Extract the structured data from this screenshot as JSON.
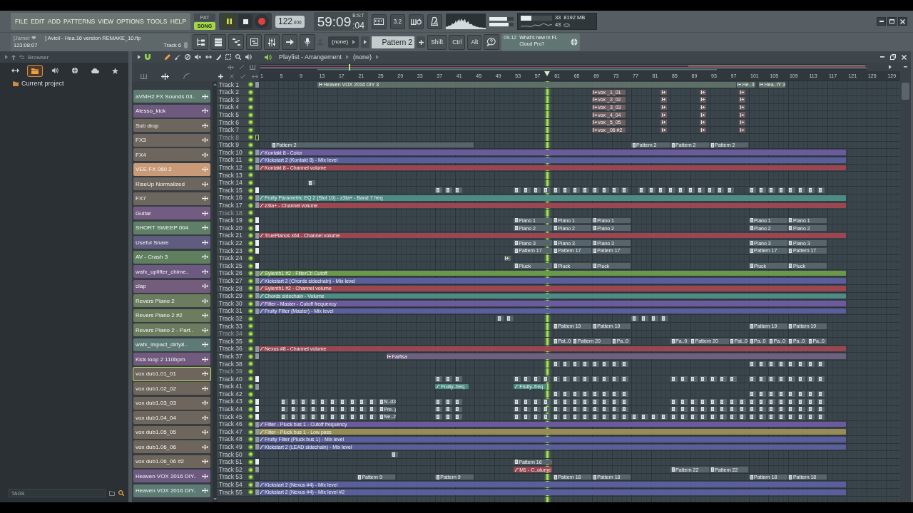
{
  "menu": [
    "FILE",
    "EDIT",
    "ADD",
    "PATTERNS",
    "VIEW",
    "OPTIONS",
    "TOOLS",
    "HELP"
  ],
  "mode": [
    {
      "label": "PAT",
      "selected": false
    },
    {
      "label": "SONG",
      "selected": true
    }
  ],
  "transport": {
    "playing": true
  },
  "tempo": {
    "value": "122",
    "fraction": ".000"
  },
  "time": {
    "main": "59:09",
    "ticks": ":04",
    "unit": "B:S:T"
  },
  "countdown": "3.2",
  "peak_meters": [
    {
      "level": 0.74
    },
    {
      "level": 0.79
    }
  ],
  "monitor": {
    "cpu_meter": {
      "level": 0.35
    },
    "cpu": "33",
    "memory": "8192 MB",
    "polyphony": "43"
  },
  "hint": {
    "owner": "[Jamer ❤",
    "text": "] Avicii - Hea.16 version REMAKE_10.flp",
    "time": "123:08:07",
    "target": "Track 6"
  },
  "pattern_selector": {
    "preset": "(none)",
    "pattern": "Pattern 2"
  },
  "modifiers": [
    "Shift",
    "Ctrl",
    "Alt"
  ],
  "news": {
    "date": "09-12",
    "text": "What's new in FL Cloud Pro?"
  },
  "browser": {
    "title": "Browser",
    "tabs": [
      {
        "kind": "arrows",
        "selected": false
      },
      {
        "kind": "folder",
        "selected": true
      },
      {
        "kind": "speaker",
        "selected": false
      },
      {
        "kind": "plugin",
        "selected": false
      },
      {
        "kind": "cloud",
        "selected": false
      },
      {
        "kind": "star",
        "selected": false
      }
    ],
    "items": [
      {
        "label": "Current project"
      }
    ],
    "tags": "TAGS"
  },
  "playlist": {
    "title": "Playlist - Arrangement",
    "arrangement": "(none)",
    "tools": [
      {
        "kind": "draw",
        "selected": true
      },
      {
        "kind": "paint",
        "selected": false
      },
      {
        "kind": "delete",
        "selected": false
      },
      {
        "kind": "mute",
        "selected": false
      },
      {
        "kind": "slip",
        "selected": false
      },
      {
        "kind": "slice",
        "selected": false
      },
      {
        "kind": "select",
        "selected": false
      },
      {
        "kind": "zoom",
        "selected": false
      },
      {
        "kind": "playback",
        "selected": false
      }
    ],
    "ruler": [
      "1",
      "5",
      "9",
      "13",
      "17",
      "21",
      "25",
      "29",
      "33",
      "37",
      "41",
      "45",
      "49",
      "53",
      "57",
      "61",
      "65",
      "69",
      "73",
      "77",
      "81",
      "85",
      "89",
      "93",
      "97",
      "101",
      "105",
      "109",
      "113",
      "117",
      "121",
      "125",
      "129"
    ],
    "picker": [
      {
        "label": "aVMH2 FX Sounds 03..",
        "color": "#5f7a70",
        "selected": false
      },
      {
        "label": "Alesso_kick",
        "color": "#6e5a7e",
        "selected": false
      },
      {
        "label": "Sub drop",
        "color": "#6d665e",
        "selected": false
      },
      {
        "label": "FX3",
        "color": "#6d665e",
        "selected": false
      },
      {
        "label": "FX4",
        "color": "#6d665e",
        "selected": false
      },
      {
        "label": "VEE FX 060 2",
        "color": "#c99a78",
        "selected": false
      },
      {
        "label": "RiseUp Normalized",
        "color": "#6d665e",
        "selected": false
      },
      {
        "label": "FX7",
        "color": "#6d665e",
        "selected": false
      },
      {
        "label": "Guitar",
        "color": "#735c82",
        "selected": false
      },
      {
        "label": "SHORT SWEEP 004",
        "color": "#5f7f66",
        "selected": false
      },
      {
        "label": "Useful Snare",
        "color": "#5f5c80",
        "selected": false
      },
      {
        "label": "AV - Crash 3",
        "color": "#5f7f5f",
        "selected": false
      },
      {
        "label": "wafx_uplifter_chime..",
        "color": "#6c5a80",
        "selected": false
      },
      {
        "label": "clap",
        "color": "#735c7c",
        "selected": false
      },
      {
        "label": "Revers Piano 2",
        "color": "#6c7c5e",
        "selected": false
      },
      {
        "label": "Revers Piano 2 #2",
        "color": "#6c7c5e",
        "selected": false
      },
      {
        "label": "Revers Piano 2 - Part..",
        "color": "#6c7c5e",
        "selected": false
      },
      {
        "label": "wafx_impact_dirty8..",
        "color": "#5e7a76",
        "selected": false
      },
      {
        "label": "Kick loop 2 110bpm",
        "color": "#725a7e",
        "selected": false
      },
      {
        "label": "vox dub1.01_01",
        "color": "#6e665c",
        "selected": true
      },
      {
        "label": "vox dub1.02_02",
        "color": "#6e665c",
        "selected": false
      },
      {
        "label": "vox dub1.03_03",
        "color": "#6e665c",
        "selected": false
      },
      {
        "label": "vox dub1.04_04",
        "color": "#6e665c",
        "selected": false
      },
      {
        "label": "vox dub1.05_05",
        "color": "#6e665c",
        "selected": false
      },
      {
        "label": "vox dub1.06_06",
        "color": "#6e665c",
        "selected": false
      },
      {
        "label": "vox dub1.06_06 #2",
        "color": "#6e665c",
        "selected": false
      },
      {
        "label": "Heaven VOX 2016 DIY..",
        "color": "#6e5a80",
        "selected": false
      },
      {
        "label": "Heaven VOX 2016 DIY..",
        "color": "#5e7a74",
        "selected": false
      }
    ],
    "tracks": [
      {
        "name": "Track 1",
        "dimmed": false,
        "selected": false,
        "color": "#8f9aa0",
        "clips": [
          {
            "kind": "audio",
            "label": "Heaven VOX 2016 DIY 3",
            "color": "#5e6f68"
          },
          {
            "kind": "audio",
            "label": "He..3",
            "color": "#5e6f68"
          },
          {
            "kind": "audio",
            "label": "Hea..IY 3",
            "color": "#5e6f68"
          }
        ]
      },
      {
        "name": "Track 2",
        "dimmed": false,
        "selected": false,
        "clips": [
          {
            "kind": "audio",
            "label": "vox _1_01",
            "color": "#6e5c5e"
          },
          {
            "kind": "audio",
            "color": "#6e5c5e"
          },
          {
            "kind": "audio",
            "color": "#6e5c5e"
          },
          {
            "kind": "audio",
            "color": "#6e5c5e"
          }
        ]
      },
      {
        "name": "Track 3",
        "dimmed": false,
        "selected": false,
        "clips": [
          {
            "kind": "audio",
            "label": "vox _2_02",
            "color": "#6e5c5e"
          },
          {
            "kind": "audio",
            "color": "#6e5c5e"
          },
          {
            "kind": "audio",
            "color": "#6e5c5e"
          },
          {
            "kind": "audio",
            "color": "#6e5c5e"
          }
        ]
      },
      {
        "name": "Track 4",
        "dimmed": false,
        "selected": false,
        "clips": [
          {
            "kind": "audio",
            "label": "vox _3_03",
            "color": "#6e5c5e"
          },
          {
            "kind": "audio",
            "color": "#6e5c5e"
          },
          {
            "kind": "audio",
            "color": "#6e5c5e"
          },
          {
            "kind": "audio",
            "color": "#6e5c5e"
          }
        ]
      },
      {
        "name": "Track 5",
        "dimmed": false,
        "selected": false,
        "clips": [
          {
            "kind": "audio",
            "label": "vox _4_04",
            "color": "#6e5c5e"
          },
          {
            "kind": "audio",
            "color": "#6e5c5e"
          },
          {
            "kind": "audio",
            "color": "#6e5c5e"
          },
          {
            "kind": "audio",
            "color": "#6e5c5e"
          }
        ]
      },
      {
        "name": "Track 6",
        "dimmed": false,
        "selected": false,
        "clips": [
          {
            "kind": "audio",
            "label": "vox _5_05",
            "color": "#6e5c5e"
          },
          {
            "kind": "audio",
            "color": "#6e5c5e"
          },
          {
            "kind": "audio",
            "color": "#6e5c5e"
          },
          {
            "kind": "audio",
            "color": "#6e5c5e"
          }
        ]
      },
      {
        "name": "Track 7",
        "dimmed": false,
        "selected": false,
        "clips": [
          {
            "kind": "audio",
            "label": "vox _06 #2",
            "color": "#6e5c5e"
          },
          {
            "kind": "audio",
            "color": "#6e5c5e"
          },
          {
            "kind": "audio",
            "color": "#6e5c5e"
          },
          {
            "kind": "audio",
            "color": "#6e5c5e"
          }
        ]
      },
      {
        "name": "Track 8",
        "dimmed": true,
        "selected": true
      },
      {
        "name": "Track 9",
        "dimmed": false,
        "selected": false,
        "clips": [
          {
            "kind": "pattern",
            "label": "Pattern 2"
          },
          {
            "kind": "pattern",
            "label": "Pattern 2"
          },
          {
            "kind": "pattern",
            "label": "Pattern 2"
          },
          {
            "kind": "pattern",
            "label": "Pattern 2"
          }
        ]
      },
      {
        "name": "Track 10",
        "dimmed": false,
        "selected": false,
        "color": "#8f9aa0",
        "clips": [
          {
            "kind": "automation",
            "label": "Kontakt 8 - Color",
            "color": "#6b5a9e"
          }
        ]
      },
      {
        "name": "Track 11",
        "dimmed": false,
        "selected": false,
        "color": "#8f9aa0",
        "clips": [
          {
            "kind": "automation",
            "label": "Kickstart 2 (Kontakt 8) - Mix level",
            "color": "#5a5e9c"
          }
        ]
      },
      {
        "name": "Track 12",
        "dimmed": false,
        "selected": false,
        "color": "#8f9aa0",
        "clips": [
          {
            "kind": "automation",
            "label": "Kontakt 8 - Channel volume",
            "color": "#9c4652"
          }
        ]
      },
      {
        "name": "Track 13",
        "dimmed": false,
        "selected": false
      },
      {
        "name": "Track 14",
        "dimmed": false,
        "selected": false,
        "clips": [
          {
            "kind": "block"
          }
        ]
      },
      {
        "name": "Track 15",
        "dimmed": false,
        "selected": false,
        "color": "#e8eef0",
        "clips": [
          {
            "kind": "block"
          },
          {
            "kind": "block"
          },
          {
            "kind": "block"
          },
          {
            "kind": "block"
          },
          {
            "kind": "block"
          },
          {
            "kind": "block"
          },
          {
            "kind": "block"
          },
          {
            "kind": "block"
          },
          {
            "kind": "block"
          },
          {
            "kind": "block"
          },
          {
            "kind": "block"
          },
          {
            "kind": "block"
          },
          {
            "kind": "block"
          },
          {
            "kind": "block"
          },
          {
            "kind": "block"
          },
          {
            "kind": "block"
          },
          {
            "kind": "block"
          },
          {
            "kind": "block"
          },
          {
            "kind": "block"
          },
          {
            "kind": "block"
          },
          {
            "kind": "block"
          },
          {
            "kind": "block"
          },
          {
            "kind": "block"
          },
          {
            "kind": "block"
          },
          {
            "kind": "block"
          },
          {
            "kind": "block"
          },
          {
            "kind": "block"
          },
          {
            "kind": "block"
          },
          {
            "kind": "block"
          },
          {
            "kind": "block"
          },
          {
            "kind": "block"
          },
          {
            "kind": "block"
          },
          {
            "kind": "block"
          }
        ]
      },
      {
        "name": "Track 16",
        "dimmed": false,
        "selected": false,
        "color": "#8f9aa0",
        "clips": [
          {
            "kind": "automation",
            "label": "Fruity Parametric EQ 2 (Slot 10) - z3ta+ - Band 7 freq",
            "color": "#4d8b84"
          }
        ]
      },
      {
        "name": "Track 17",
        "dimmed": false,
        "selected": false,
        "color": "#8f9aa0",
        "clips": [
          {
            "kind": "automation",
            "label": "z3ta+ - Channel volume",
            "color": "#9c4652"
          }
        ]
      },
      {
        "name": "Track 18",
        "dimmed": true,
        "selected": false
      },
      {
        "name": "Track 19",
        "dimmed": false,
        "selected": false,
        "color": "#e8eef0",
        "clips": [
          {
            "kind": "pattern",
            "label": "Piano 1"
          },
          {
            "kind": "pattern",
            "label": "Piano 1"
          },
          {
            "kind": "pattern",
            "label": "Piano 1"
          },
          {
            "kind": "pattern",
            "label": "Piano 1"
          },
          {
            "kind": "pattern",
            "label": "Piano 1"
          }
        ]
      },
      {
        "name": "Track 20",
        "dimmed": false,
        "selected": false,
        "color": "#e8eef0",
        "clips": [
          {
            "kind": "pattern",
            "label": "Piano 2"
          },
          {
            "kind": "pattern",
            "label": "Piano 2"
          },
          {
            "kind": "pattern",
            "label": "Piano 2"
          },
          {
            "kind": "pattern",
            "label": "Piano 2"
          },
          {
            "kind": "pattern",
            "label": "Piano 2"
          }
        ]
      },
      {
        "name": "Track 21",
        "dimmed": false,
        "selected": false,
        "color": "#8f9aa0",
        "clips": [
          {
            "kind": "automation",
            "label": "TruePianos x64 - Channel volume",
            "color": "#9c4652"
          }
        ]
      },
      {
        "name": "Track 22",
        "dimmed": false,
        "selected": false,
        "color": "#e8eef0",
        "clips": [
          {
            "kind": "pattern",
            "label": "Piano 3"
          },
          {
            "kind": "pattern",
            "label": "Piano 3"
          },
          {
            "kind": "pattern",
            "label": "Piano 3"
          },
          {
            "kind": "pattern",
            "label": "Piano 3"
          },
          {
            "kind": "pattern",
            "label": "Piano 3"
          }
        ]
      },
      {
        "name": "Track 23",
        "dimmed": false,
        "selected": false,
        "color": "#e8eef0",
        "clips": [
          {
            "kind": "pattern",
            "label": "Pattern 17"
          },
          {
            "kind": "pattern",
            "label": "Pattern 17"
          },
          {
            "kind": "pattern",
            "label": "Pattern 17"
          },
          {
            "kind": "pattern",
            "label": "Pattern 17"
          },
          {
            "kind": "pattern",
            "label": "Pattern 17"
          }
        ]
      },
      {
        "name": "Track 24",
        "dimmed": false,
        "selected": false,
        "clips": [
          {
            "kind": "audio",
            "color": "#5e6c67"
          }
        ]
      },
      {
        "name": "Track 25",
        "dimmed": false,
        "selected": false,
        "color": "#e8eef0",
        "clips": [
          {
            "kind": "pattern",
            "label": "Pluck"
          },
          {
            "kind": "pattern",
            "label": "Pluck"
          },
          {
            "kind": "pattern",
            "label": "Pluck"
          },
          {
            "kind": "pattern",
            "label": "Pluck"
          },
          {
            "kind": "pattern",
            "label": "Pluck"
          }
        ]
      },
      {
        "name": "Track 26",
        "dimmed": false,
        "selected": false,
        "color": "#8f9aa0",
        "clips": [
          {
            "kind": "automation",
            "label": "Sylenth1 #2 - FilterCtl Cutoff",
            "color": "#6a994a"
          }
        ]
      },
      {
        "name": "Track 27",
        "dimmed": false,
        "selected": false,
        "color": "#8f9aa0",
        "clips": [
          {
            "kind": "automation",
            "label": "Kickstart 2 (Chords sidechain) - Mix level",
            "color": "#5a5e9c"
          }
        ]
      },
      {
        "name": "Track 28",
        "dimmed": false,
        "selected": false,
        "color": "#8f9aa0",
        "clips": [
          {
            "kind": "automation",
            "label": "Sylenth1 #2 - Channel volume",
            "color": "#9c4652"
          }
        ]
      },
      {
        "name": "Track 29",
        "dimmed": false,
        "selected": false,
        "color": "#8f9aa0",
        "clips": [
          {
            "kind": "automation",
            "label": "Chords sidechain - Volume",
            "color": "#4d8b84"
          }
        ]
      },
      {
        "name": "Track 30",
        "dimmed": false,
        "selected": false,
        "color": "#8f9aa0",
        "clips": [
          {
            "kind": "automation",
            "label": "Filter - Master - Cutoff frequency",
            "color": "#6b5a9e"
          }
        ]
      },
      {
        "name": "Track 31",
        "dimmed": false,
        "selected": false,
        "color": "#8f9aa0",
        "clips": [
          {
            "kind": "automation",
            "label": "Fruity Filter (Master) - Mix level",
            "color": "#5a5e9c"
          }
        ]
      },
      {
        "name": "Track 32",
        "dimmed": false,
        "selected": false,
        "clips": [
          {
            "kind": "block"
          },
          {
            "kind": "block"
          },
          {
            "kind": "block"
          },
          {
            "kind": "block"
          },
          {
            "kind": "block"
          },
          {
            "kind": "block"
          }
        ]
      },
      {
        "name": "Track 33",
        "dimmed": false,
        "selected": false,
        "clips": [
          {
            "kind": "pattern",
            "label": "Pattern 19"
          },
          {
            "kind": "pattern",
            "label": "Pattern 19"
          },
          {
            "kind": "pattern",
            "label": "Pattern 19"
          },
          {
            "kind": "pattern",
            "label": "Pattern 19"
          }
        ]
      },
      {
        "name": "Track 34",
        "dimmed": true,
        "selected": false
      },
      {
        "name": "Track 35",
        "dimmed": false,
        "selected": false,
        "clips": [
          {
            "kind": "pattern",
            "label": "Pat..0"
          },
          {
            "kind": "pattern",
            "label": "Pattern 20"
          },
          {
            "kind": "pattern",
            "label": "Pa..0"
          },
          {
            "kind": "pattern",
            "label": "Pa..0"
          },
          {
            "kind": "pattern",
            "label": "Pattern 20"
          },
          {
            "kind": "pattern",
            "label": "Pat..0"
          },
          {
            "kind": "pattern",
            "label": "Pa..0"
          },
          {
            "kind": "pattern",
            "label": "Pa..0"
          },
          {
            "kind": "pattern",
            "label": "Pa..0"
          },
          {
            "kind": "pattern",
            "label": "Pa..0"
          }
        ]
      },
      {
        "name": "Track 36",
        "dimmed": false,
        "selected": false,
        "color": "#8f9aa0",
        "clips": [
          {
            "kind": "automation",
            "label": "Nexus #8 - Channel volume",
            "color": "#9c4652"
          }
        ]
      },
      {
        "name": "Track 37",
        "dimmed": false,
        "selected": false,
        "color": "#8f9aa0",
        "clips": [
          {
            "kind": "audio",
            "label": "Farfisa",
            "color": "#6d6080"
          }
        ]
      },
      {
        "name": "Track 38",
        "dimmed": false,
        "selected": false,
        "clips": [
          {
            "kind": "block"
          },
          {
            "kind": "block"
          },
          {
            "kind": "block"
          },
          {
            "kind": "block"
          },
          {
            "kind": "block"
          },
          {
            "kind": "block"
          },
          {
            "kind": "block"
          },
          {
            "kind": "block"
          },
          {
            "kind": "block"
          },
          {
            "kind": "block"
          },
          {
            "kind": "block"
          },
          {
            "kind": "block"
          },
          {
            "kind": "block"
          },
          {
            "kind": "block"
          },
          {
            "kind": "block"
          },
          {
            "kind": "block"
          }
        ]
      },
      {
        "name": "Track 39",
        "dimmed": true,
        "selected": false
      },
      {
        "name": "Track 40",
        "dimmed": false,
        "selected": false,
        "color": "#e8eef0",
        "clips": [
          {
            "kind": "block"
          },
          {
            "kind": "block"
          },
          {
            "kind": "block"
          },
          {
            "kind": "block"
          },
          {
            "kind": "block"
          },
          {
            "kind": "block"
          },
          {
            "kind": "block"
          },
          {
            "kind": "block"
          },
          {
            "kind": "block"
          },
          {
            "kind": "block"
          },
          {
            "kind": "block"
          },
          {
            "kind": "block"
          },
          {
            "kind": "block"
          },
          {
            "kind": "block"
          },
          {
            "kind": "block"
          },
          {
            "kind": "block"
          },
          {
            "kind": "block"
          },
          {
            "kind": "block"
          },
          {
            "kind": "block"
          },
          {
            "kind": "block"
          },
          {
            "kind": "block"
          },
          {
            "kind": "block"
          },
          {
            "kind": "block"
          },
          {
            "kind": "block"
          },
          {
            "kind": "block"
          },
          {
            "kind": "block"
          },
          {
            "kind": "block"
          },
          {
            "kind": "block"
          },
          {
            "kind": "block"
          },
          {
            "kind": "block"
          }
        ]
      },
      {
        "name": "Track 41",
        "dimmed": false,
        "selected": false,
        "color": "#8f9aa0",
        "clips": [
          {
            "kind": "automation",
            "label": "Fruity..freq",
            "color": "#4d8b84"
          },
          {
            "kind": "automation",
            "label": "Fruity..freq",
            "color": "#4d8b84"
          }
        ]
      },
      {
        "name": "Track 42",
        "dimmed": false,
        "selected": false,
        "clips": [
          {
            "kind": "block"
          },
          {
            "kind": "block"
          },
          {
            "kind": "block"
          },
          {
            "kind": "block"
          },
          {
            "kind": "block"
          },
          {
            "kind": "block"
          },
          {
            "kind": "block"
          },
          {
            "kind": "block"
          },
          {
            "kind": "block"
          },
          {
            "kind": "block"
          },
          {
            "kind": "block"
          },
          {
            "kind": "block"
          },
          {
            "kind": "block"
          },
          {
            "kind": "block"
          },
          {
            "kind": "block"
          },
          {
            "kind": "block"
          }
        ]
      },
      {
        "name": "Track 43",
        "dimmed": false,
        "selected": false,
        "color": "#e8eef0",
        "clips": [
          {
            "kind": "block"
          },
          {
            "kind": "block"
          },
          {
            "kind": "block"
          },
          {
            "kind": "block"
          },
          {
            "kind": "block"
          },
          {
            "kind": "block"
          },
          {
            "kind": "block"
          },
          {
            "kind": "block"
          },
          {
            "kind": "block"
          },
          {
            "kind": "block"
          },
          {
            "kind": "pattern",
            "label": "N..d3"
          },
          {
            "kind": "block"
          },
          {
            "kind": "block"
          },
          {
            "kind": "block"
          },
          {
            "kind": "block"
          },
          {
            "kind": "block"
          },
          {
            "kind": "block"
          },
          {
            "kind": "block"
          },
          {
            "kind": "block"
          },
          {
            "kind": "block"
          },
          {
            "kind": "block"
          },
          {
            "kind": "block"
          },
          {
            "kind": "block"
          },
          {
            "kind": "block"
          },
          {
            "kind": "block"
          },
          {
            "kind": "block"
          },
          {
            "kind": "block"
          },
          {
            "kind": "block"
          },
          {
            "kind": "block"
          },
          {
            "kind": "block"
          },
          {
            "kind": "block"
          },
          {
            "kind": "block"
          },
          {
            "kind": "block"
          },
          {
            "kind": "block"
          },
          {
            "kind": "block"
          },
          {
            "kind": "block"
          },
          {
            "kind": "block"
          },
          {
            "kind": "block"
          },
          {
            "kind": "block"
          },
          {
            "kind": "block"
          },
          {
            "kind": "block"
          },
          {
            "kind": "block"
          }
        ]
      },
      {
        "name": "Track 44",
        "dimmed": false,
        "selected": false,
        "color": "#e8eef0",
        "clips": [
          {
            "kind": "block"
          },
          {
            "kind": "block"
          },
          {
            "kind": "block"
          },
          {
            "kind": "block"
          },
          {
            "kind": "block"
          },
          {
            "kind": "block"
          },
          {
            "kind": "block"
          },
          {
            "kind": "block"
          },
          {
            "kind": "block"
          },
          {
            "kind": "block"
          },
          {
            "kind": "pattern",
            "label": "Pre..)"
          },
          {
            "kind": "block"
          },
          {
            "kind": "block"
          },
          {
            "kind": "block"
          },
          {
            "kind": "block"
          },
          {
            "kind": "block"
          },
          {
            "kind": "block"
          },
          {
            "kind": "block"
          },
          {
            "kind": "block"
          },
          {
            "kind": "block"
          },
          {
            "kind": "block"
          },
          {
            "kind": "block"
          },
          {
            "kind": "block"
          },
          {
            "kind": "block"
          },
          {
            "kind": "block"
          },
          {
            "kind": "block"
          },
          {
            "kind": "block"
          },
          {
            "kind": "block"
          },
          {
            "kind": "block"
          },
          {
            "kind": "block"
          },
          {
            "kind": "block"
          },
          {
            "kind": "block"
          },
          {
            "kind": "block"
          },
          {
            "kind": "block"
          },
          {
            "kind": "block"
          },
          {
            "kind": "block"
          },
          {
            "kind": "block"
          },
          {
            "kind": "block"
          },
          {
            "kind": "block"
          },
          {
            "kind": "block"
          },
          {
            "kind": "block"
          },
          {
            "kind": "block"
          }
        ]
      },
      {
        "name": "Track 45",
        "dimmed": false,
        "selected": false,
        "color": "#e8eef0",
        "clips": [
          {
            "kind": "block"
          },
          {
            "kind": "block"
          },
          {
            "kind": "block"
          },
          {
            "kind": "block"
          },
          {
            "kind": "block"
          },
          {
            "kind": "block"
          },
          {
            "kind": "block"
          },
          {
            "kind": "block"
          },
          {
            "kind": "block"
          },
          {
            "kind": "block"
          },
          {
            "kind": "pattern",
            "label": "Ne..2"
          },
          {
            "kind": "block"
          },
          {
            "kind": "block"
          },
          {
            "kind": "block"
          },
          {
            "kind": "block"
          },
          {
            "kind": "block"
          },
          {
            "kind": "block"
          },
          {
            "kind": "block"
          },
          {
            "kind": "block"
          },
          {
            "kind": "block"
          },
          {
            "kind": "block"
          },
          {
            "kind": "block"
          },
          {
            "kind": "block"
          },
          {
            "kind": "block"
          },
          {
            "kind": "block"
          },
          {
            "kind": "block"
          },
          {
            "kind": "block"
          },
          {
            "kind": "block"
          },
          {
            "kind": "block"
          },
          {
            "kind": "block"
          },
          {
            "kind": "block"
          },
          {
            "kind": "block"
          },
          {
            "kind": "block"
          },
          {
            "kind": "block"
          },
          {
            "kind": "block"
          },
          {
            "kind": "block"
          },
          {
            "kind": "block"
          },
          {
            "kind": "block"
          },
          {
            "kind": "block"
          },
          {
            "kind": "block"
          },
          {
            "kind": "block"
          },
          {
            "kind": "block"
          },
          {
            "kind": "block"
          },
          {
            "kind": "block"
          },
          {
            "kind": "block"
          },
          {
            "kind": "block"
          }
        ]
      },
      {
        "name": "Track 46",
        "dimmed": false,
        "selected": false,
        "color": "#8f9aa0",
        "clips": [
          {
            "kind": "automation",
            "label": "Filter - Pluck bus 1 - Cutoff frequency",
            "color": "#6b5a9e"
          }
        ]
      },
      {
        "name": "Track 47",
        "dimmed": false,
        "selected": false,
        "color": "#8f9aa0",
        "clips": [
          {
            "kind": "automation",
            "label": "Filter - Pluck bus 1 - Low pass",
            "color": "#978c55"
          }
        ]
      },
      {
        "name": "Track 48",
        "dimmed": false,
        "selected": false,
        "color": "#8f9aa0",
        "clips": [
          {
            "kind": "automation",
            "label": "Fruity Filter (Pluck bus 1) - Mix level",
            "color": "#5a5e9c"
          }
        ]
      },
      {
        "name": "Track 49",
        "dimmed": false,
        "selected": false,
        "color": "#8f9aa0",
        "clips": [
          {
            "kind": "automation",
            "label": "Kickstart 2 (LEAD sidechain) - Mix level",
            "color": "#5a5e9c"
          }
        ]
      },
      {
        "name": "Track 50",
        "dimmed": false,
        "selected": false,
        "clips": [
          {
            "kind": "block"
          }
        ]
      },
      {
        "name": "Track 51",
        "dimmed": false,
        "selected": false,
        "color": "#e8eef0",
        "clips": [
          {
            "kind": "pattern",
            "label": "Pattern 16"
          }
        ]
      },
      {
        "name": "Track 52",
        "dimmed": false,
        "selected": false,
        "color": "#8f9aa0",
        "clips": [
          {
            "kind": "automation",
            "label": "M1 - C..olume",
            "color": "#9c4652"
          },
          {
            "kind": "pattern",
            "label": "Pattern 22"
          },
          {
            "kind": "pattern",
            "label": "Pattern 22"
          }
        ]
      },
      {
        "name": "Track 53",
        "dimmed": false,
        "selected": false,
        "clips": [
          {
            "kind": "pattern",
            "label": "Pattern 9"
          },
          {
            "kind": "pattern",
            "label": "Pattern 9"
          },
          {
            "kind": "pattern",
            "label": "Pattern 18"
          },
          {
            "kind": "pattern",
            "label": "Pattern 18"
          },
          {
            "kind": "pattern",
            "label": "Pattern 18"
          },
          {
            "kind": "pattern",
            "label": "Pattern 18"
          }
        ]
      },
      {
        "name": "Track 54",
        "dimmed": false,
        "selected": false,
        "color": "#8f9aa0",
        "clips": [
          {
            "kind": "automation",
            "label": "Kickstart 2 (Nexus #4) - Mix level",
            "color": "#5a5e9c"
          }
        ]
      },
      {
        "name": "Track 55",
        "dimmed": false,
        "selected": false,
        "color": "#8f9aa0",
        "clips": [
          {
            "kind": "automation",
            "label": "Kickstart 2 (Nexus #4) - Mix level #2",
            "color": "#5a5e9c"
          }
        ]
      }
    ]
  }
}
